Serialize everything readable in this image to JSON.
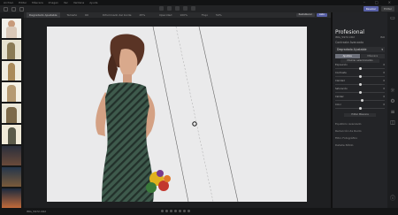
{
  "menubar": {
    "items": [
      "Archivo",
      "Editar",
      "Máscara",
      "Imagen",
      "Ver",
      "Ventana",
      "Ayuda"
    ]
  },
  "toolbar": {
    "button_primary": "Revelar",
    "button_secondary": "Editar"
  },
  "optbar": {
    "tool": "Degradado Ajustable",
    "fields": [
      {
        "label": "Tamaño",
        "value": "60"
      },
      {
        "label": "Difuminado del borde",
        "value": "25%"
      },
      {
        "label": "Opacidad",
        "value": "100%"
      },
      {
        "label": "Flujo",
        "value": "50%"
      }
    ],
    "btn_reset": "Restablecer",
    "btn_done": "Listo"
  },
  "panel": {
    "title": "Profesional",
    "filename": "IMG_5972.CR2",
    "fileinfo": "ISO",
    "section1": "Contraste Avanzado",
    "section2": "Degradado Ajustable",
    "tabs": [
      "Ajustes",
      "Máscara"
    ],
    "pill": "Mostrar seleccionados",
    "sliders": [
      {
        "label": "Exposición",
        "value": "0",
        "pos": 0.5
      },
      {
        "label": "Contraste",
        "value": "0",
        "pos": 0.5
      },
      {
        "label": "Claridad",
        "value": "0",
        "pos": 0.5
      },
      {
        "label": "Saturación",
        "value": "0",
        "pos": 0.5
      },
      {
        "label": "Calidez",
        "value": "0",
        "pos": 0.55
      },
      {
        "label": "Color",
        "value": "0",
        "pos": 0.5
      }
    ],
    "more_button": "Editar Máscara",
    "links": [
      "Equilibrio Avanzado",
      "Reducción de Ruido",
      "Filtro Fotográfico",
      "Detalle Nítido"
    ]
  },
  "statusbar": {
    "filename": "IMG_5972.CR2"
  },
  "colors": {
    "accent": "#5860a6",
    "panel": "#232427",
    "canvas": "#1e1f21"
  },
  "icons": [
    "close-icon",
    "minimize-icon",
    "maximize-icon",
    "sun-icon",
    "gear-icon",
    "layers-icon",
    "histogram-icon",
    "info-icon"
  ]
}
